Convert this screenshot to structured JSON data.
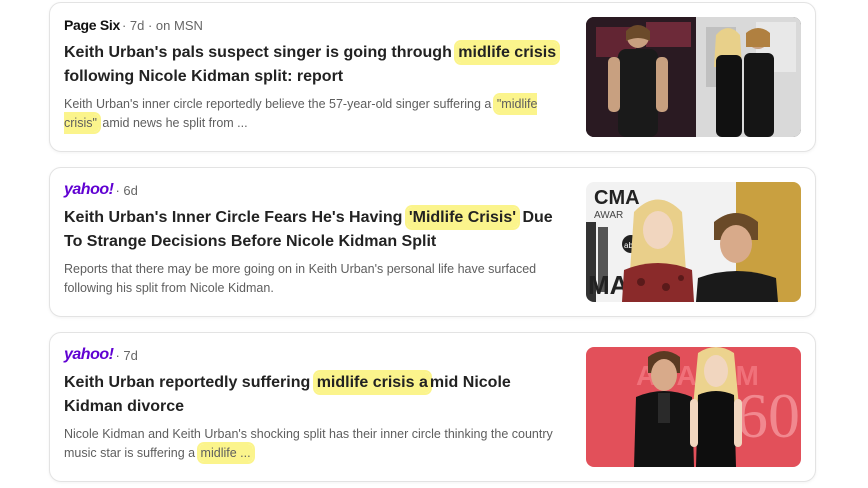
{
  "articles": [
    {
      "source": "Page Six",
      "meta": "· 7d · on MSN",
      "title_parts": [
        "Keith Urban's pals suspect singer is going through ",
        "midlife crisis",
        " following Nicole Kidman split: report"
      ],
      "snippet_parts": [
        "Keith Urban's inner circle reportedly believe the 57-year-old singer suffering a ",
        "\"midlife crisis\"",
        " amid news he split from ..."
      ],
      "thumb_icon": "photo-keith-urban-red-carpet"
    },
    {
      "source": "yahoo!",
      "meta": "· 6d",
      "title_parts": [
        "Keith Urban's Inner Circle Fears He's Having ",
        "'Midlife Crisis'",
        " Due To Strange Decisions Before Nicole Kidman Split"
      ],
      "snippet_parts": [
        "Reports that there may be more going on in Keith Urban's personal life have surfaced following his split from Nicole Kidman.",
        "",
        ""
      ],
      "thumb_icon": "photo-kidman-urban-cma-awards"
    },
    {
      "source": "yahoo!",
      "meta": "· 7d",
      "title_parts": [
        "Keith Urban reportedly suffering ",
        "midlife crisis a",
        "mid Nicole Kidman divorce"
      ],
      "snippet_parts": [
        "Nicole Kidman and Keith Urban's shocking split has their inner circle thinking the country music star is suffering a ",
        "midlife ...",
        ""
      ],
      "thumb_icon": "photo-kidman-urban-academy-event"
    }
  ],
  "colors": {
    "highlight": "#fbf48c",
    "yahoo_purple": "#6001d2",
    "title": "#222222",
    "snippet": "#5e5e5e"
  }
}
